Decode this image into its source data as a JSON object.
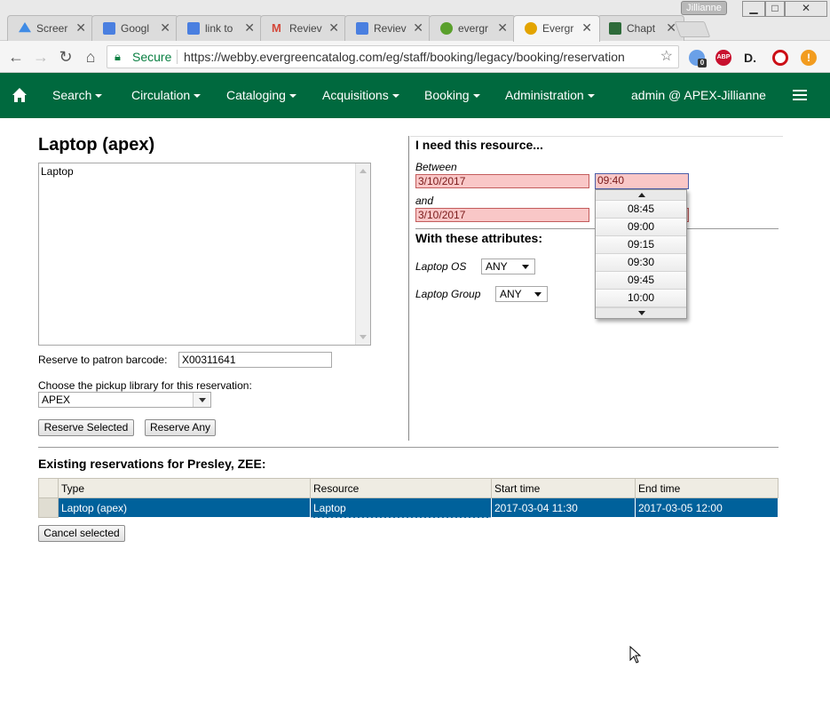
{
  "browser": {
    "profile_name": "Jillianne",
    "tabs": [
      {
        "label": "Screer",
        "icon": "drive-icon",
        "color": "#3f8be5"
      },
      {
        "label": "Googl",
        "icon": "docs-icon",
        "color": "#4a7fe0"
      },
      {
        "label": "link to",
        "icon": "docs-icon",
        "color": "#4a7fe0"
      },
      {
        "label": "Reviev",
        "icon": "gmail-icon",
        "color": "#d44638"
      },
      {
        "label": "Reviev",
        "icon": "docs-icon",
        "color": "#4a7fe0"
      },
      {
        "label": "evergr",
        "icon": "evergreen-icon",
        "color": "#5aa02c"
      },
      {
        "label": "Evergr",
        "icon": "evergreen-icon",
        "color": "#e3a400"
      },
      {
        "label": "Chapt",
        "icon": "book-icon",
        "color": "#2e6b3a"
      }
    ],
    "secure_label": "Secure",
    "url": "https://webby.evergreencatalog.com/eg/staff/booking/legacy/booking/reservation",
    "ext_badge": "0",
    "ext_abp": "ABP",
    "ext_d": "D."
  },
  "nav": {
    "items": [
      "Search",
      "Circulation",
      "Cataloging",
      "Acquisitions",
      "Booking",
      "Administration"
    ],
    "user": "admin @ APEX-Jillianne"
  },
  "left": {
    "resource_title": "Laptop (apex)",
    "resource_items": [
      "Laptop"
    ],
    "patron_label": "Reserve to patron barcode:",
    "patron_barcode": "X00311641",
    "pickup_label": "Choose the pickup library for this reservation:",
    "pickup_value": "APEX",
    "reserve_selected": "Reserve Selected",
    "reserve_any": "Reserve Any"
  },
  "right": {
    "need_title": "I need this resource...",
    "between_label": "Between",
    "start_date": "3/10/2017",
    "start_time": "09:40",
    "and_label": "and",
    "end_date": "3/10/2017",
    "attributes_title": "With these attributes:",
    "attributes": [
      {
        "label": "Laptop OS",
        "value": "ANY"
      },
      {
        "label": "Laptop Group",
        "value": "ANY"
      }
    ],
    "time_options": [
      "08:45",
      "09:00",
      "09:15",
      "09:30",
      "09:45",
      "10:00"
    ]
  },
  "existing": {
    "title": "Existing reservations for Presley, ZEE:",
    "columns": [
      "Type",
      "Resource",
      "Start time",
      "End time"
    ],
    "rows": [
      {
        "type": "Laptop (apex)",
        "resource": "Laptop",
        "start": "2017-03-04 11:30",
        "end": "2017-03-05 12:00"
      }
    ],
    "cancel_label": "Cancel selected"
  },
  "colors": {
    "nav_green": "#00693e",
    "selected_row": "#00619b",
    "invalid_field": "#f9c7c7"
  }
}
